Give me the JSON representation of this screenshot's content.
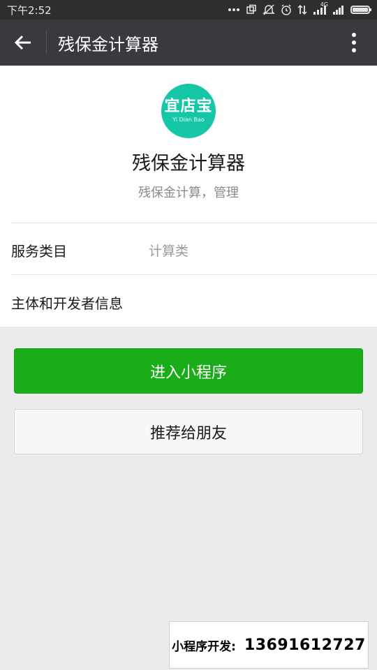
{
  "status_bar": {
    "time": "下午2:52",
    "network_label": "4G",
    "icons": [
      "more-dots-icon",
      "screen-icon",
      "mute-icon",
      "alarm-icon",
      "data-transfer-icon",
      "signal-4g-icon",
      "signal-icon",
      "battery-icon"
    ],
    "battery_level": 1.0
  },
  "nav": {
    "title": "残保金计算器",
    "back_icon": "arrow-left-icon",
    "more_icon": "more-vertical-icon"
  },
  "app": {
    "logo_text": "宜店宝",
    "logo_subtext": "Yi Dian Bao",
    "name": "残保金计算器",
    "description": "残保金计算，管理"
  },
  "info": {
    "service_category_label": "服务类目",
    "service_category_value": "计算类",
    "developer_info_label": "主体和开发者信息"
  },
  "buttons": {
    "enter_label": "进入小程序",
    "share_label": "推荐给朋友"
  },
  "ad": {
    "label": "小程序开发:",
    "phone": "13691612727"
  },
  "colors": {
    "status_bar_bg": "#2e2e2e",
    "nav_bg": "#393a3f",
    "primary_green": "#1aad19",
    "logo_teal": "#16c7a7",
    "page_bg": "#ebebeb"
  }
}
